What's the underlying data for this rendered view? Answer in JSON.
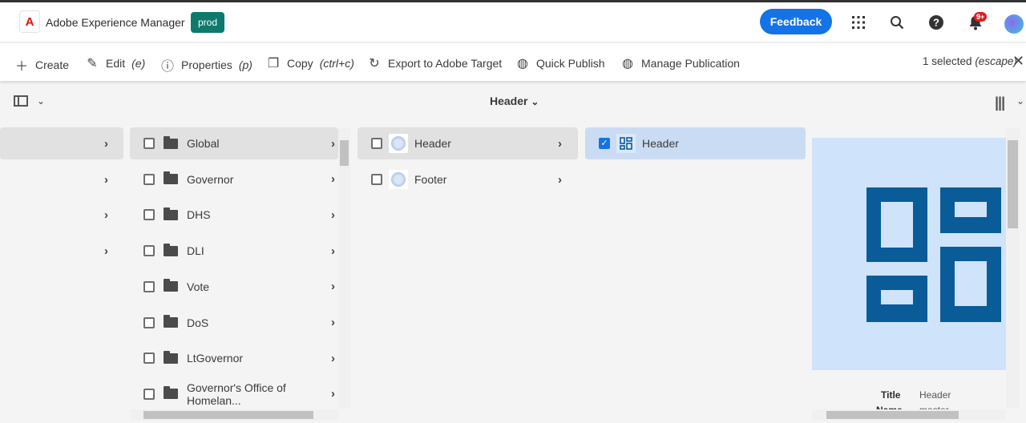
{
  "header": {
    "app_title": "Adobe Experience Manager",
    "logo_letter": "A",
    "environment": "prod",
    "feedback_label": "Feedback",
    "notification_badge": "9+",
    "accent_color": "#1473e6"
  },
  "toolbar": {
    "create": "Create",
    "edit": "Edit",
    "edit_shortcut": "(e)",
    "properties": "Properties",
    "properties_shortcut": "(p)",
    "copy": "Copy",
    "copy_shortcut": "(ctrl+c)",
    "export": "Export to Adobe Target",
    "quick_publish": "Quick Publish",
    "manage_publication": "Manage Publication",
    "selection": "1 selected",
    "selection_shortcut": "(escape)"
  },
  "subheader": {
    "title": "Header"
  },
  "columns": {
    "folders": [
      {
        "label": "Global",
        "highlighted": true
      },
      {
        "label": "Governor"
      },
      {
        "label": "DHS"
      },
      {
        "label": "DLI"
      },
      {
        "label": "Vote"
      },
      {
        "label": "DoS"
      },
      {
        "label": "LtGovernor"
      },
      {
        "label": "Governor's Office of Homelan..."
      }
    ],
    "pages": [
      {
        "label": "Header",
        "highlighted": true
      },
      {
        "label": "Footer"
      }
    ],
    "selected": {
      "label": "Header",
      "checked": true
    }
  },
  "preview": {
    "title_label": "Title",
    "title_value": "Header",
    "name_label": "Name",
    "name_value": "master",
    "icon_color": "#0a5c99"
  }
}
